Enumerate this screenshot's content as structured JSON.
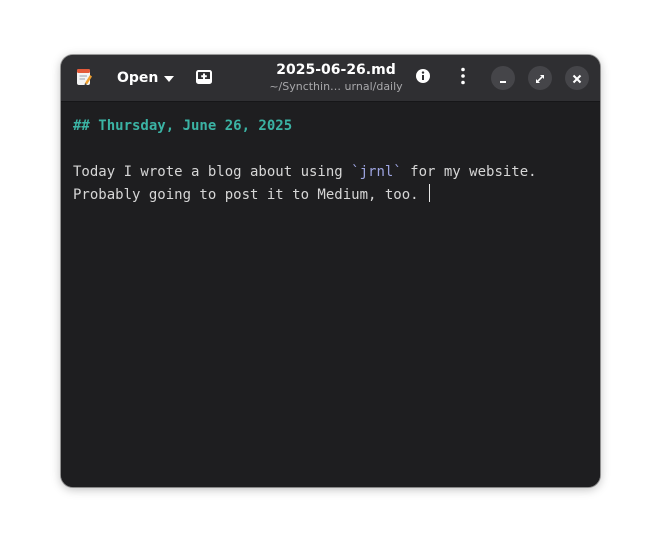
{
  "header": {
    "open_label": "Open",
    "title": "2025-06-26.md",
    "subtitle": "~/Syncthin… urnal/daily"
  },
  "editor": {
    "heading": "## Thursday, June 26, 2025",
    "line1_before": "Today I wrote a blog about using ",
    "line1_code": "`jrnl`",
    "line1_after": " for my website.",
    "line2": "Probably going to post it to Medium, too. "
  },
  "icons": {
    "app": "text-editor-app-icon",
    "open_dropdown": "chevron-down-icon",
    "new_tab": "new-tab-icon",
    "info": "info-icon",
    "menu": "kebab-menu-icon",
    "minimize": "minimize-icon",
    "maximize": "maximize-icon",
    "close": "close-icon"
  },
  "colors": {
    "window_bg": "#1e1e20",
    "headerbar_bg": "#2f2f32",
    "heading": "#3bb3a4",
    "code": "#9da4e0",
    "text": "#d6d6d6"
  }
}
